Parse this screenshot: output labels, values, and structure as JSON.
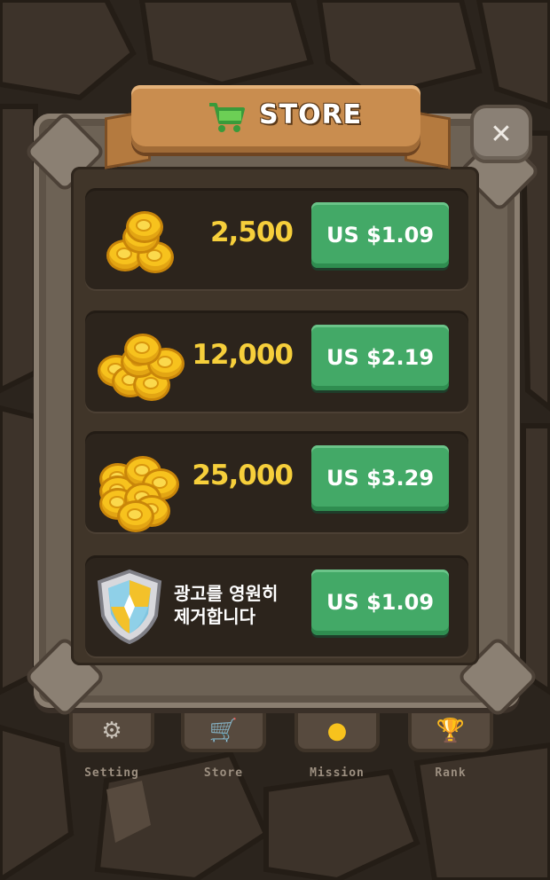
{
  "header": {
    "title": "STORE",
    "cart_icon": "shopping-cart-icon",
    "close_icon": "close-icon"
  },
  "items": [
    {
      "amount": "2,500",
      "price": "US $1.09",
      "icon": "coins-small-icon"
    },
    {
      "amount": "12,000",
      "price": "US $2.19",
      "icon": "coins-medium-icon"
    },
    {
      "amount": "25,000",
      "price": "US $3.29",
      "icon": "coins-large-icon"
    },
    {
      "text_line1": "광고를 영원히",
      "text_line2": "제거합니다",
      "price": "US $1.09",
      "icon": "shield-icon"
    }
  ],
  "bottom_nav": [
    {
      "label": "Setting",
      "icon": "gear-icon",
      "color": "#9c8f80"
    },
    {
      "label": "Store",
      "icon": "shopping-cart-icon",
      "color": "#9c8f80"
    },
    {
      "label": "Mission",
      "icon": "coin-icon",
      "color": "#9c8f80"
    },
    {
      "label": "Rank",
      "icon": "trophy-icon",
      "color": "#9c8f80"
    }
  ],
  "colors": {
    "price_button": "#43a967",
    "amount_text": "#f6cf3b",
    "banner": "#c98d4f",
    "panel_frame": "#6d6255"
  }
}
